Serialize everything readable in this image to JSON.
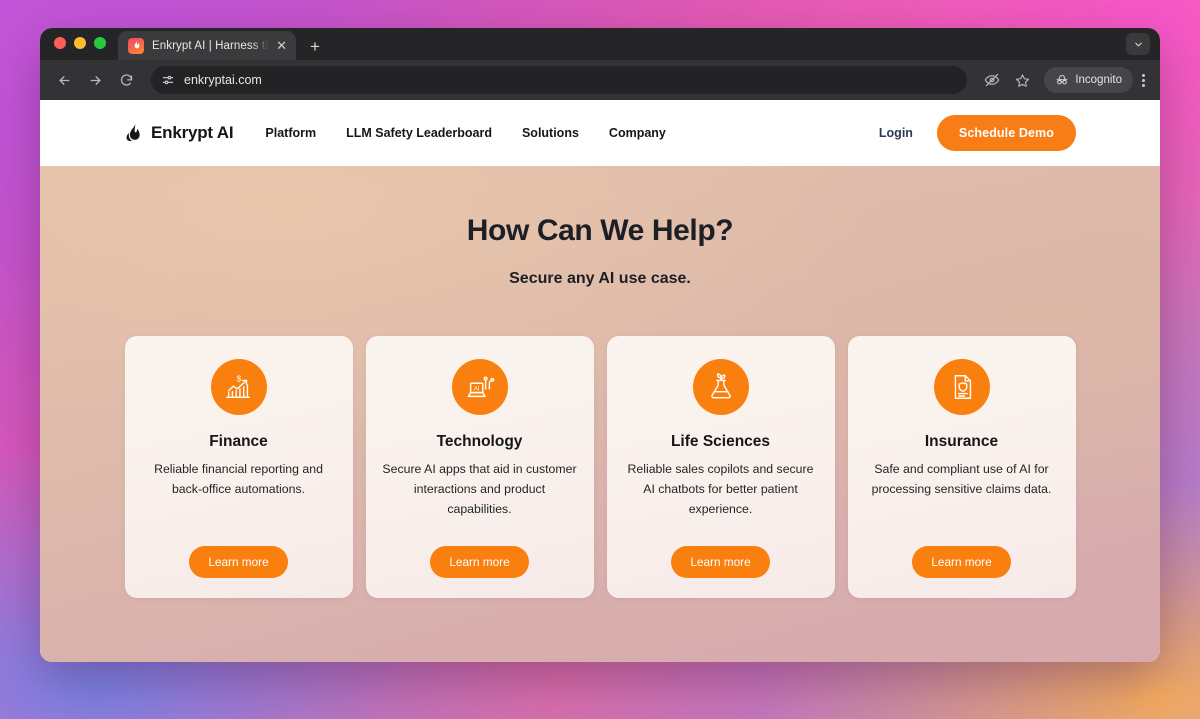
{
  "browser": {
    "tab": {
      "title": "Enkrypt AI | Harness the Power",
      "close_label": "✕",
      "favicon": "flame-favicon"
    },
    "new_tab_label": "+",
    "address": "enkryptai.com",
    "incognito_label": "Incognito",
    "icons": {
      "back": "back-arrow-icon",
      "forward": "forward-arrow-icon",
      "reload": "reload-icon",
      "site_info": "site-settings-icon",
      "tracking": "eye-slash-icon",
      "bookmark": "star-icon",
      "incognito": "incognito-icon",
      "menu": "kebab-menu-icon",
      "window_chevron": "chevron-down-icon"
    }
  },
  "site": {
    "brand": {
      "name": "Enkrypt AI",
      "logo": "flame-logo"
    },
    "nav_links": [
      {
        "label": "Platform"
      },
      {
        "label": "LLM Safety Leaderboard"
      },
      {
        "label": "Solutions"
      },
      {
        "label": "Company"
      }
    ],
    "login_label": "Login",
    "cta_label": "Schedule Demo"
  },
  "hero": {
    "heading": "How Can We Help?",
    "subheading": "Secure any AI use case."
  },
  "cards": [
    {
      "icon": "finance-chart-icon",
      "title": "Finance",
      "description": "Reliable financial reporting and back-office automations.",
      "button": "Learn more"
    },
    {
      "icon": "laptop-ai-icon",
      "title": "Technology",
      "description": "Secure AI apps that aid in customer interactions and product capabilities.",
      "button": "Learn more"
    },
    {
      "icon": "flask-plant-icon",
      "title": "Life Sciences",
      "description": "Reliable sales copilots and secure AI chatbots for better patient experience.",
      "button": "Learn more"
    },
    {
      "icon": "document-shield-icon",
      "title": "Insurance",
      "description": "Safe and compliant use of AI for processing sensitive claims data.",
      "button": "Learn more"
    }
  ],
  "colors": {
    "accent": "#f9800f",
    "cta": "#f97d16",
    "text": "#14161a",
    "card_bg": "#fbf4ee"
  }
}
